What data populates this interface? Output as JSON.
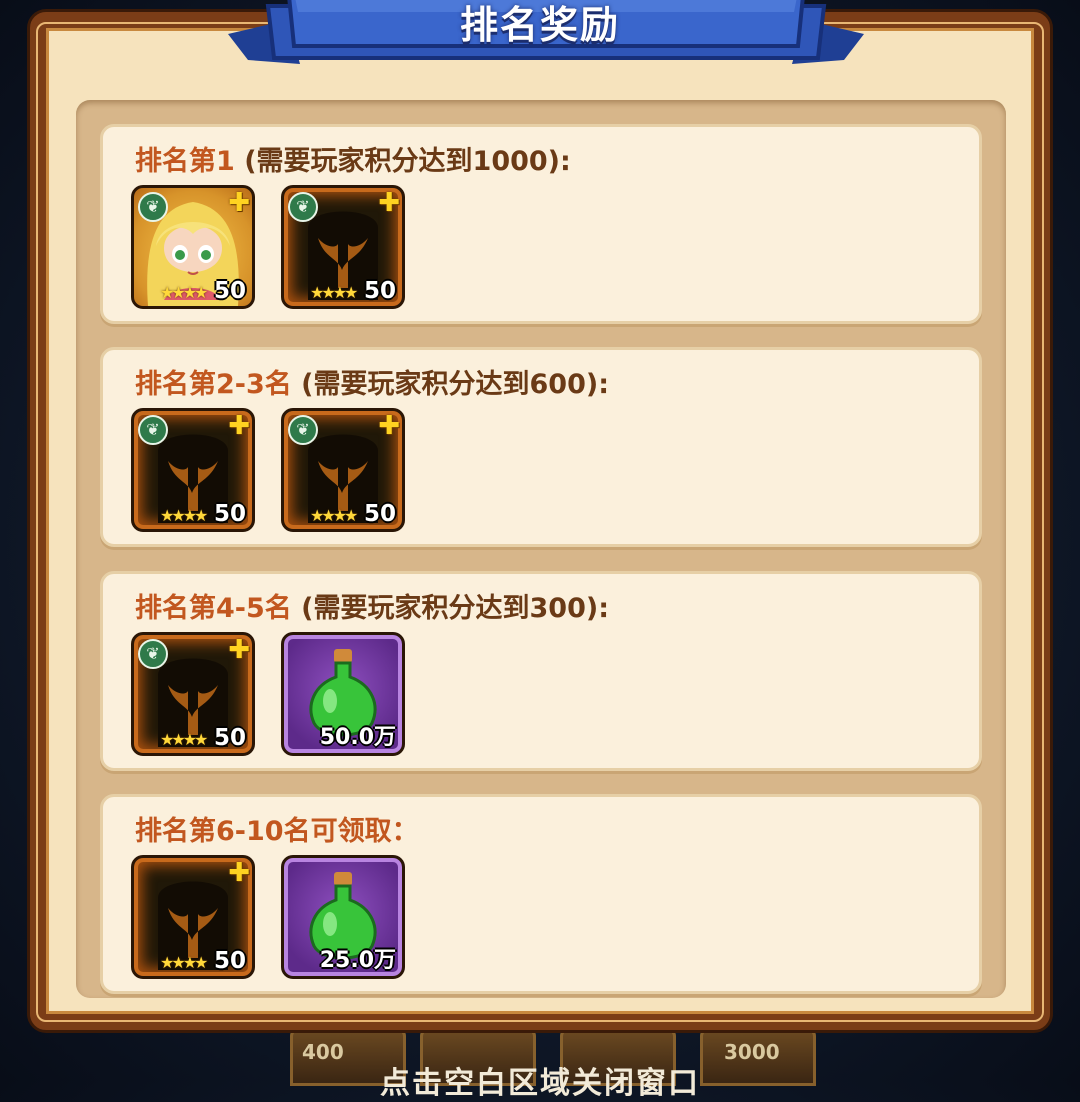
{
  "panel": {
    "title": "排名奖励"
  },
  "background": {
    "left_value": "400",
    "right_value": "3000"
  },
  "close_hint": "点击空白区域关闭窗口",
  "colors": {
    "panel_border": "#7b3d17",
    "panel_fill": "#f6e3bd",
    "ribbon_blue": "#2f56b8",
    "rank_text": "#c2571f",
    "condition_text": "#6a3a16"
  },
  "tiers": [
    {
      "rank_label": "排名第1",
      "condition": " (需要玩家积分达到1000):",
      "rewards": [
        {
          "kind": "hero",
          "icon": "blonde-hero-portrait",
          "element_badge": "❦",
          "corner_icon": "puzzle-fragment-icon",
          "stars": "★★★★",
          "level": "50"
        },
        {
          "kind": "fragment",
          "icon": "hero-silhouette-fragment",
          "element_badge": "❦",
          "corner_icon": "puzzle-fragment-icon",
          "stars": "★★★★",
          "level": "50"
        }
      ]
    },
    {
      "rank_label": "排名第2-3名",
      "condition": " (需要玩家积分达到600):",
      "rewards": [
        {
          "kind": "fragment",
          "icon": "hero-silhouette-fragment",
          "element_badge": "❦",
          "corner_icon": "puzzle-fragment-icon",
          "stars": "★★★★",
          "level": "50"
        },
        {
          "kind": "fragment",
          "icon": "hero-silhouette-fragment",
          "element_badge": "❦",
          "corner_icon": "puzzle-fragment-icon",
          "stars": "★★★★",
          "level": "50"
        }
      ]
    },
    {
      "rank_label": "排名第4-5名",
      "condition": " (需要玩家积分达到300):",
      "rewards": [
        {
          "kind": "fragment",
          "icon": "hero-silhouette-fragment",
          "element_badge": "❦",
          "corner_icon": "puzzle-fragment-icon",
          "stars": "★★★★",
          "level": "50"
        },
        {
          "kind": "potion",
          "icon": "green-exp-potion",
          "amount": "50.0万"
        }
      ]
    },
    {
      "rank_label": "排名第6-10名可领取：",
      "condition": "",
      "rewards": [
        {
          "kind": "fragment",
          "icon": "hero-silhouette-fragment",
          "corner_icon": "puzzle-fragment-icon",
          "stars": "★★★★",
          "level": "50"
        },
        {
          "kind": "potion",
          "icon": "green-exp-potion",
          "amount": "25.0万"
        }
      ]
    }
  ]
}
